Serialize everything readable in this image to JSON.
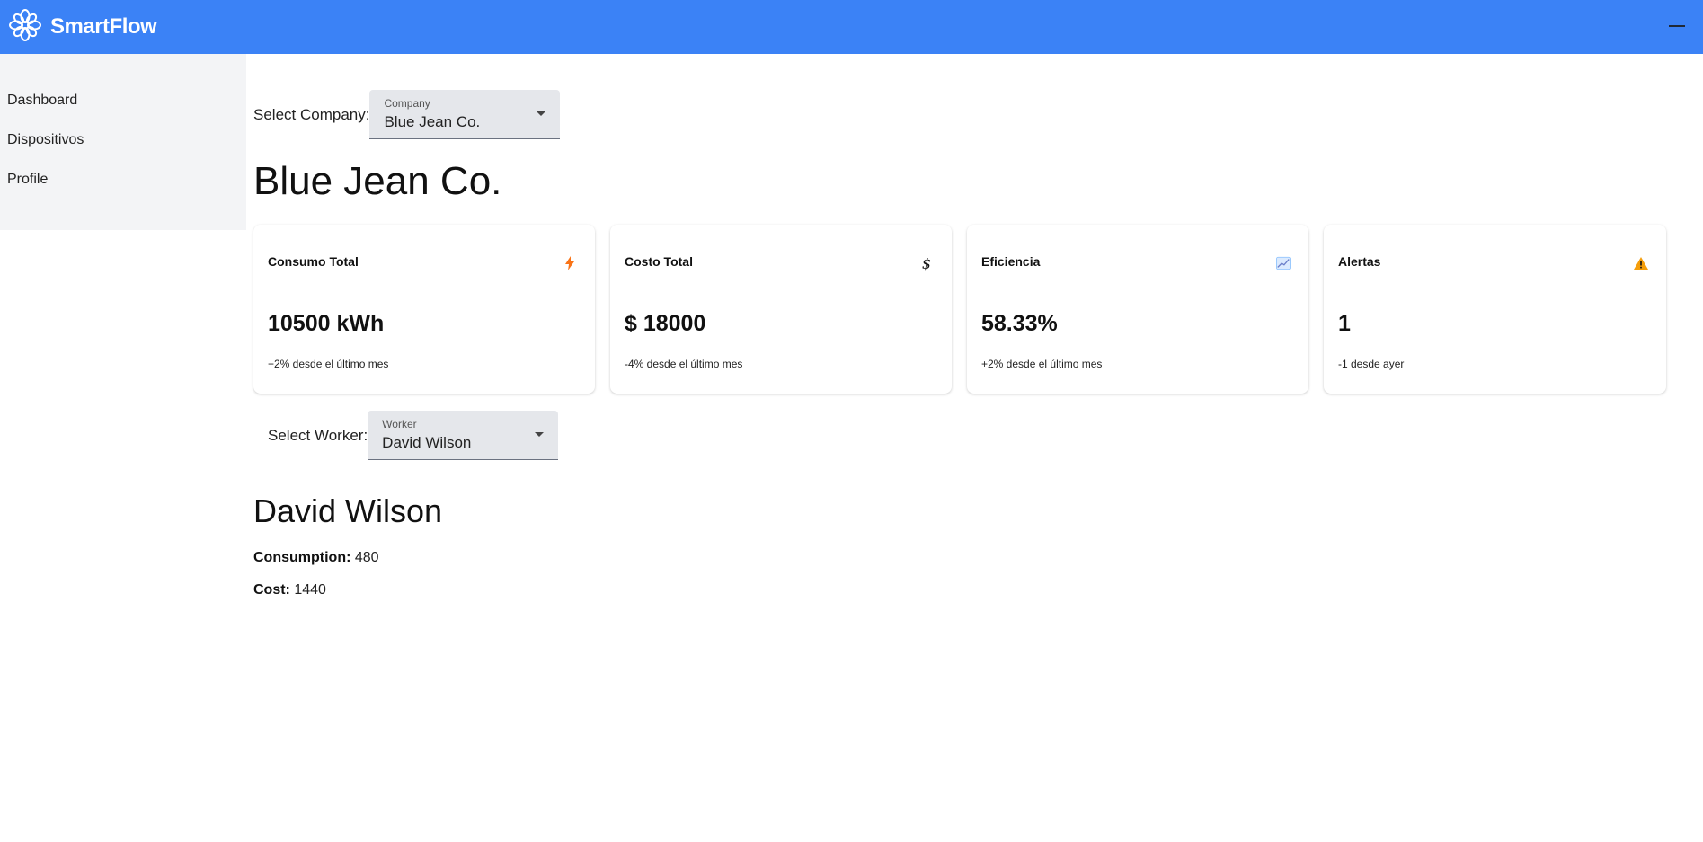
{
  "app": {
    "name": "SmartFlow",
    "logo_icon": "flower-logo-icon",
    "menu_icon": "minus-icon"
  },
  "sidebar": {
    "items": [
      {
        "label": "Dashboard"
      },
      {
        "label": "Dispositivos"
      },
      {
        "label": "Profile"
      }
    ]
  },
  "company_select": {
    "label": "Select Company:",
    "caption": "Company",
    "value": "Blue Jean Co."
  },
  "company": {
    "name": "Blue Jean Co."
  },
  "cards": [
    {
      "title": "Consumo Total",
      "value": "10500 kWh",
      "change": "+2% desde el último mes",
      "icon": "lightning-icon"
    },
    {
      "title": "Costo Total",
      "value": "$ 18000",
      "change": "-4% desde el último mes",
      "icon": "dollar-icon"
    },
    {
      "title": "Eficiencia",
      "value": "58.33%",
      "change": "+2% desde el último mes",
      "icon": "trend-chart-icon"
    },
    {
      "title": "Alertas",
      "value": "1",
      "change": "-1 desde ayer",
      "icon": "warning-icon"
    }
  ],
  "worker_select": {
    "label": "Select Worker:",
    "caption": "Worker",
    "value": "David Wilson"
  },
  "worker": {
    "name": "David Wilson",
    "consumption_label": "Consumption:",
    "consumption_value": "480",
    "cost_label": "Cost:",
    "cost_value": "1440"
  },
  "colors": {
    "header": "#3b82f6",
    "sidebar": "#f3f4f6",
    "select_bg": "#e5e7eb"
  }
}
